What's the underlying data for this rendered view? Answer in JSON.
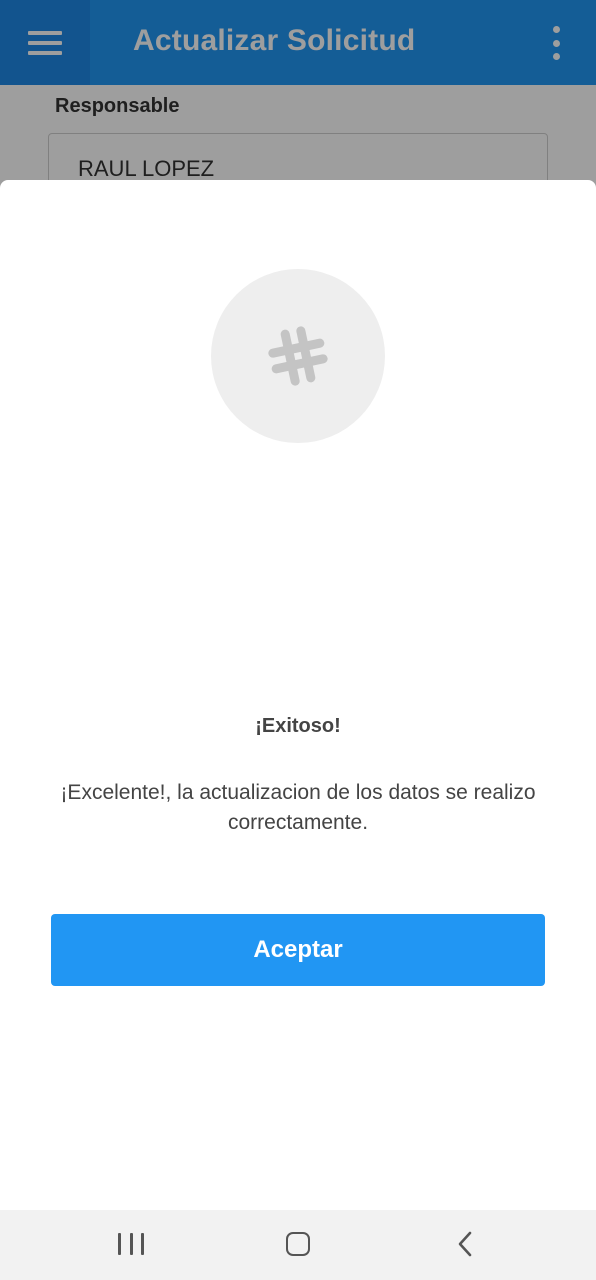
{
  "appbar": {
    "title": "Actualizar Solicitud",
    "menu_icon": "hamburger-menu-icon",
    "overflow_icon": "more-vert-icon",
    "color": "#2196f3"
  },
  "form": {
    "responsable_label": "Responsable",
    "responsable_value": "RAUL LOPEZ"
  },
  "dialog": {
    "icon": "hashtag-icon",
    "title": "¡Exitoso!",
    "message": "¡Excelente!, la actualizacion de los datos se realizo correctamente.",
    "accept_label": "Aceptar",
    "accent_color": "#2196f3"
  },
  "system_nav": {
    "recent_icon": "recent-apps-icon",
    "home_icon": "home-icon",
    "back_icon": "back-icon"
  }
}
